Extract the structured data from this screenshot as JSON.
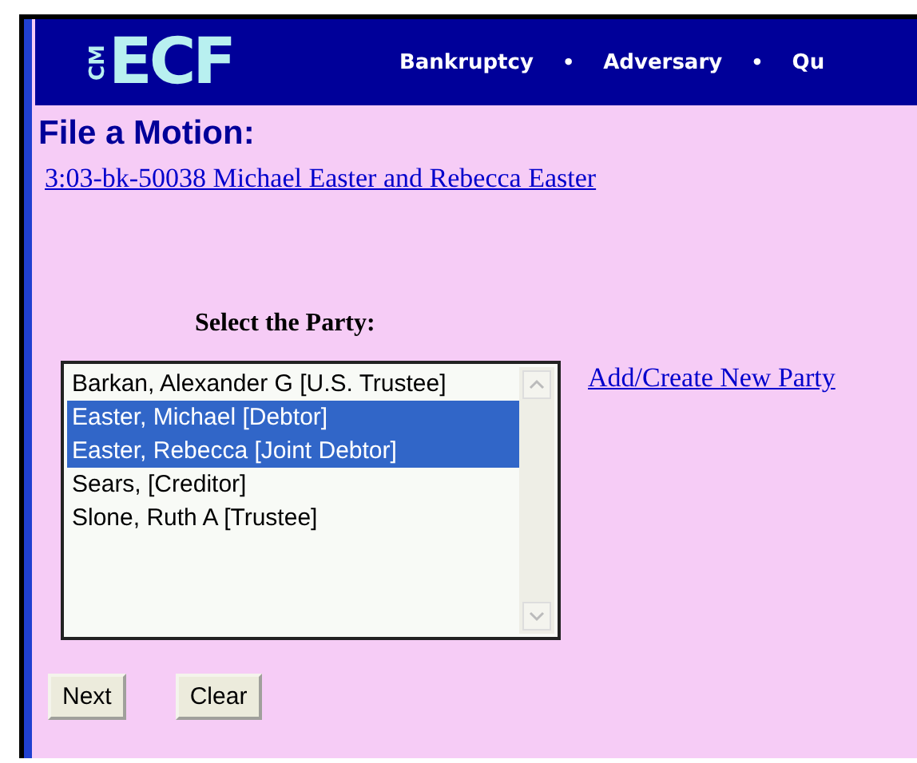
{
  "logo": {
    "small": "CM",
    "large": "ECF"
  },
  "nav": [
    {
      "label": "Bankruptcy"
    },
    {
      "label": "•",
      "kind": "separator"
    },
    {
      "label": "Adversary"
    },
    {
      "label": "•",
      "kind": "separator"
    },
    {
      "label": "Qu"
    }
  ],
  "title": "File a Motion:",
  "case_link": "3:03-bk-50038 Michael Easter and Rebecca Easter",
  "party_label": "Select the Party:",
  "parties": [
    {
      "label": "Barkan, Alexander G [U.S. Trustee]",
      "selected": false
    },
    {
      "label": "Easter, Michael [Debtor]",
      "selected": true
    },
    {
      "label": "Easter, Rebecca [Joint Debtor]",
      "selected": true
    },
    {
      "label": "Sears, [Creditor]",
      "selected": false
    },
    {
      "label": "Slone, Ruth A [Trustee]",
      "selected": false
    }
  ],
  "add_party_link": "Add/Create New Party",
  "buttons": [
    "Next",
    "Clear"
  ]
}
